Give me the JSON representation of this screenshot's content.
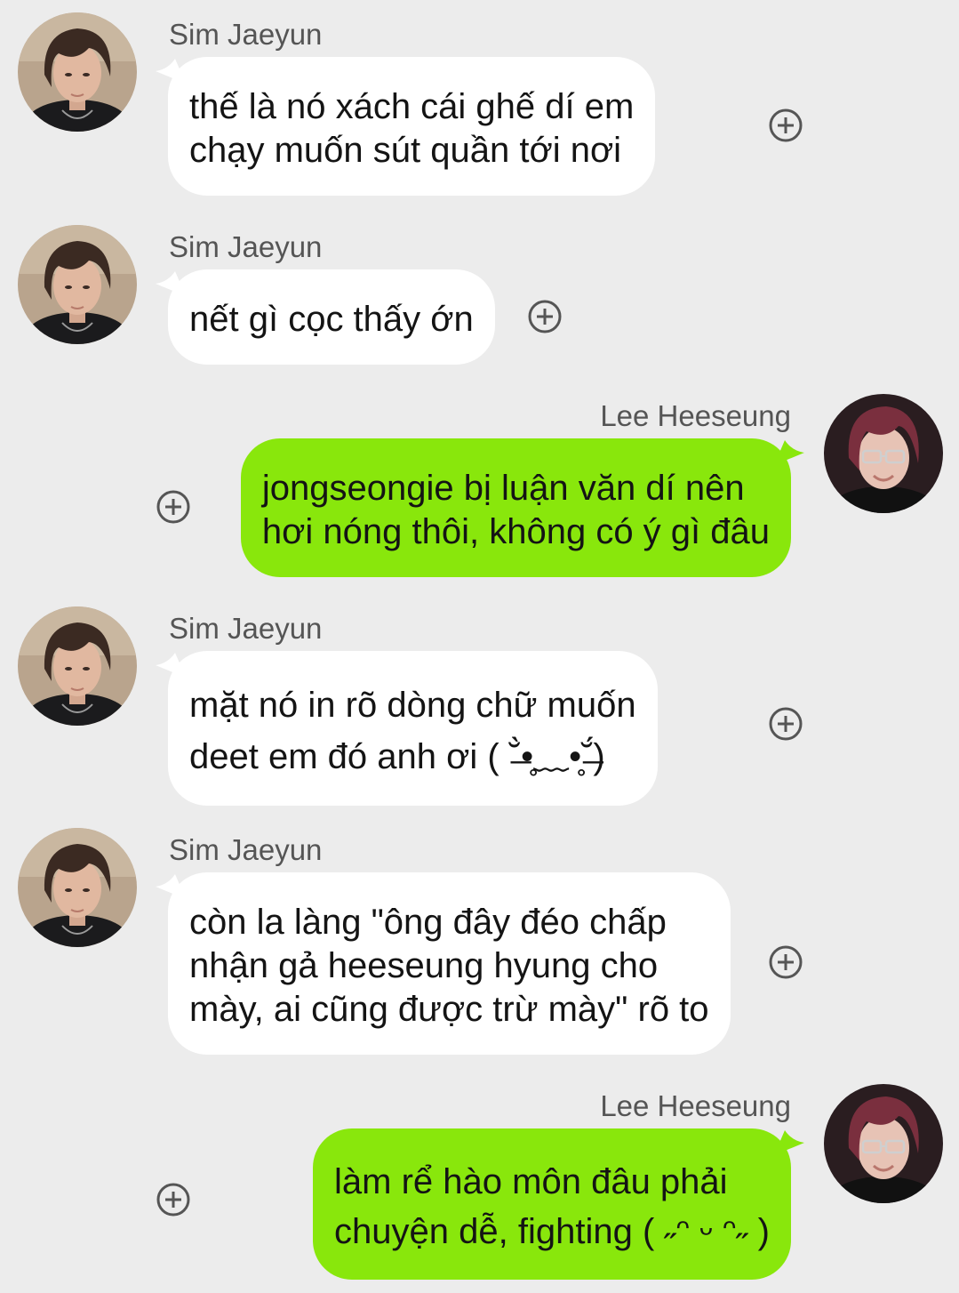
{
  "conversation": {
    "messages": [
      {
        "side": "left",
        "sender": "Sim Jaeyun",
        "text": "thế là nó xách cái ghế dí em\nchạy muốn sút quần tới nơi"
      },
      {
        "side": "left",
        "sender": "Sim Jaeyun",
        "text": "nết gì cọc thấy ớn"
      },
      {
        "side": "right",
        "sender": "Lee Heeseung",
        "text": "jongseongie bị luận văn dí nên\nhơi nóng thôi, không có ý gì đâu"
      },
      {
        "side": "left",
        "sender": "Sim Jaeyun",
        "text": "mặt nó in rõ dòng chữ muốn\ndeet em đó anh ơi ( ˘̶̀•̥﹏•̥˘̶́)"
      },
      {
        "side": "left",
        "sender": "Sim Jaeyun",
        "text": "còn la làng \"ông đây đéo chấp\nnhận gả heeseung hyung cho\nmày, ai cũng được trừ mày\" rõ to"
      },
      {
        "side": "right",
        "sender": "Lee Heeseung",
        "text": "làm rể hào môn đâu phải\nchuyện dễ, fighting ( ˶ᵔ ᵕ ᵔ˶ )"
      }
    ]
  },
  "icons": {
    "add": "plus-circle-icon",
    "avatar_jaeyun": "avatar-photo",
    "avatar_heeseung": "avatar-photo"
  },
  "colors": {
    "background": "#ececec",
    "incoming_bubble": "#ffffff",
    "outgoing_bubble": "#89e70c",
    "sender_name": "#555555",
    "message_text": "#141414",
    "add_icon": "#555555"
  }
}
